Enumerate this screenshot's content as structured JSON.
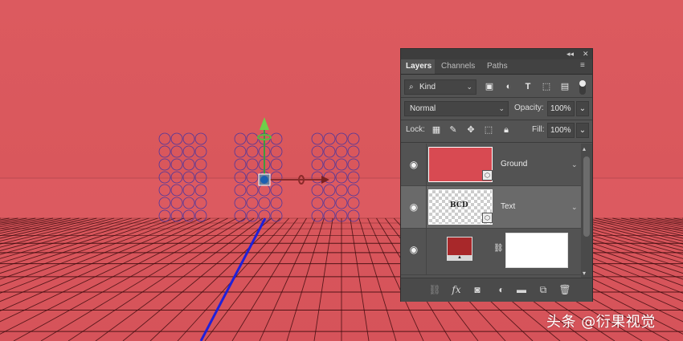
{
  "colors": {
    "canvas_red": "#d9575c",
    "grid_line": "#3a0a0c",
    "circle_outline": "#2b2fae",
    "panel_bg": "#535353",
    "ground_thumb": "#d84a52",
    "fill_swatch": "#a8282a"
  },
  "panel": {
    "collapse_glyph": "◂◂",
    "close_glyph": "✕",
    "tabs": [
      {
        "label": "Layers",
        "active": true
      },
      {
        "label": "Channels",
        "active": false
      },
      {
        "label": "Paths",
        "active": false
      }
    ],
    "menu_icon": "panel-menu-icon",
    "filter": {
      "value": "Kind",
      "icons": [
        "image-filter-icon",
        "adjustment-filter-icon",
        "type-filter-icon",
        "shape-filter-icon",
        "smart-object-filter-icon",
        "filter-toggle-icon"
      ]
    },
    "blend_mode": "Normal",
    "opacity_label": "Opacity:",
    "opacity_value": "100%",
    "lock_label": "Lock:",
    "lock_icons": [
      "lock-transparent-icon",
      "lock-image-icon",
      "lock-position-icon",
      "lock-artboard-icon",
      "lock-all-icon"
    ],
    "fill_label": "Fill:",
    "fill_value": "100%",
    "layers": [
      {
        "name": "Ground",
        "visible": true
      },
      {
        "name": "Text",
        "visible": true,
        "thumb_text": "BCD"
      },
      {
        "name": "",
        "visible": true
      }
    ],
    "bottom_icons": [
      "link-layers-icon",
      "fx-icon",
      "add-mask-icon",
      "adjustment-layer-icon",
      "new-group-icon",
      "new-layer-icon",
      "delete-layer-icon"
    ],
    "fx_label": "fx"
  },
  "watermark": "头条 @衍果视觉"
}
